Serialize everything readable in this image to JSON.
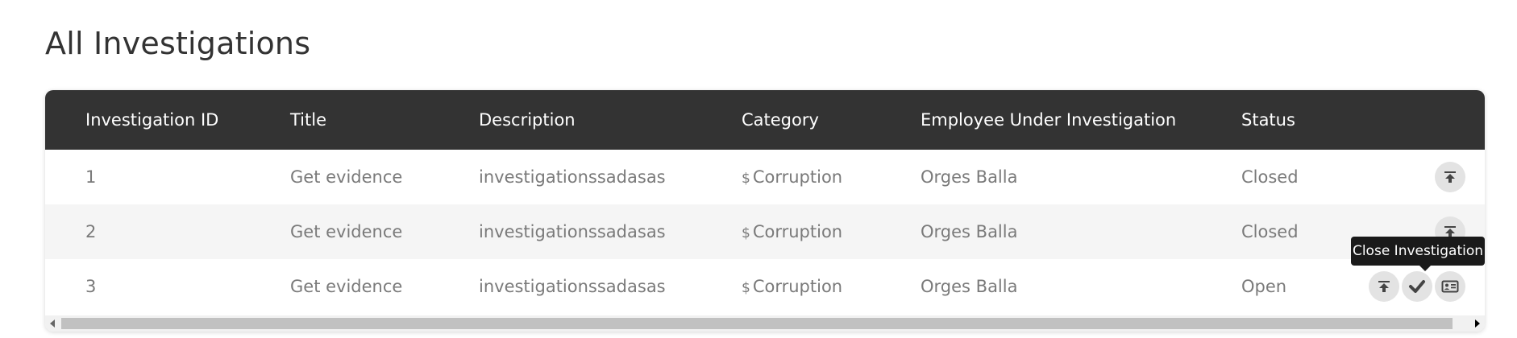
{
  "page": {
    "title": "All Investigations"
  },
  "table": {
    "headers": {
      "id": "Investigation ID",
      "title": "Title",
      "description": "Description",
      "category": "Category",
      "employee": "Employee Under Investigation",
      "status": "Status"
    },
    "rows": [
      {
        "id": "1",
        "title": "Get evidence",
        "description": "investigationssadasas",
        "category_icon": "$",
        "category": "Corruption",
        "employee": "Orges Balla",
        "status": "Closed",
        "actions": [
          "upload-icon"
        ]
      },
      {
        "id": "2",
        "title": "Get evidence",
        "description": "investigationssadasas",
        "category_icon": "$",
        "category": "Corruption",
        "employee": "Orges Balla",
        "status": "Closed",
        "actions": [
          "upload-icon"
        ]
      },
      {
        "id": "3",
        "title": "Get evidence",
        "description": "investigationssadasas",
        "category_icon": "$",
        "category": "Corruption",
        "employee": "Orges Balla",
        "status": "Open",
        "actions": [
          "upload-icon",
          "checkmark-icon",
          "id-card-icon"
        ]
      }
    ]
  },
  "tooltip": {
    "text": "Close Investigation"
  },
  "colors": {
    "header_bg": "#333333",
    "header_text": "#ffffff",
    "row_text": "#7a7a7a",
    "row_alt_bg": "#f5f5f5",
    "action_button_bg": "#e3e3e3",
    "tooltip_bg": "#1a1a1a"
  }
}
